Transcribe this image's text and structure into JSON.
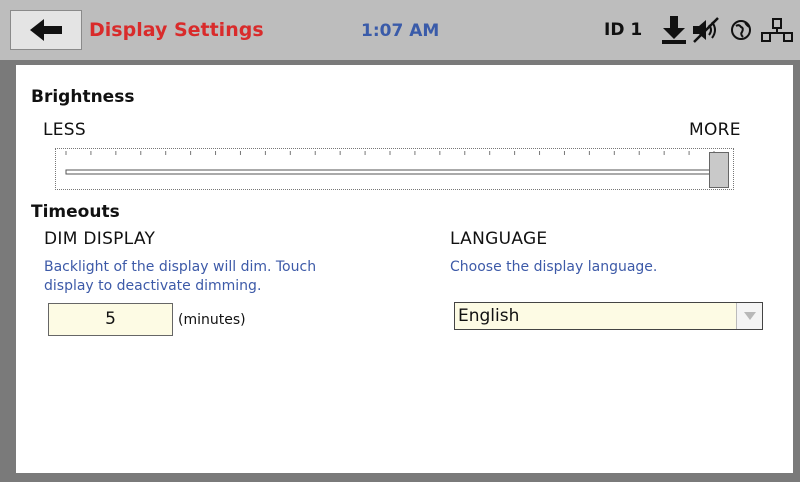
{
  "header": {
    "back_icon": "arrow-left-icon",
    "title": "Display Settings",
    "time": "1:07 AM",
    "id_label": "ID 1",
    "status_icons": [
      "download-icon",
      "mute-icon",
      "globe-icon",
      "network-icon"
    ],
    "colors": {
      "title": "#d92b2b",
      "time": "#3a5ba9"
    }
  },
  "brightness": {
    "heading": "Brightness",
    "min_label": "LESS",
    "max_label": "MORE",
    "level": 1.0
  },
  "timeouts": {
    "heading": "Timeouts",
    "dim_display": {
      "label": "DIM DISPLAY",
      "hint_line1": "Backlight of the display will dim.  Touch",
      "hint_line2": "display to deactivate dimming.",
      "value": "5",
      "units": "(minutes)"
    },
    "language": {
      "label": "LANGUAGE",
      "hint": "Choose the display language.",
      "selected": "English"
    }
  }
}
